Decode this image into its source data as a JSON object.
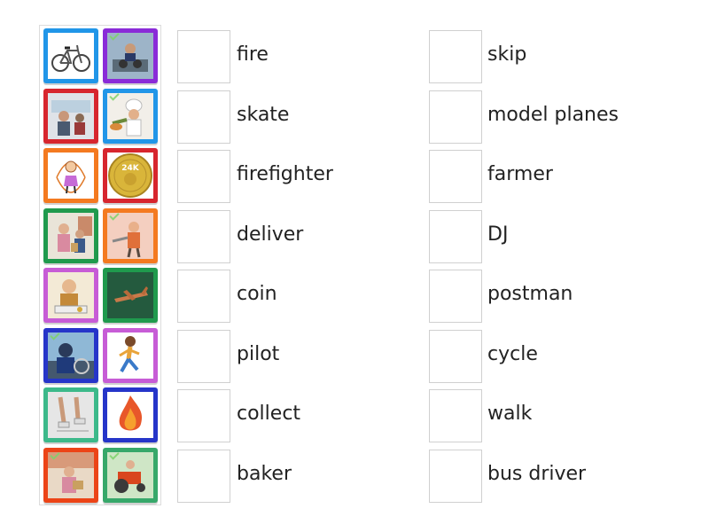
{
  "colors": {
    "red": "#d7262e",
    "purple": "#8a2bd8",
    "blue": "#2196e8",
    "orange": "#f47a20",
    "green": "#1f9a4d",
    "magenta": "#c75cd6",
    "navy": "#2635c9",
    "teal": "#3cb98a",
    "orangered": "#ec4417",
    "seagreen": "#37a86a"
  },
  "tiles": [
    {
      "icon": "bicycle-icon",
      "color": "#2196e8"
    },
    {
      "icon": "dj-icon",
      "color": "#8a2bd8"
    },
    {
      "icon": "bus-driver-icon",
      "color": "#d7262e"
    },
    {
      "icon": "baker-icon",
      "color": "#2196e8"
    },
    {
      "icon": "skipping-girl-icon",
      "color": "#f47a20"
    },
    {
      "icon": "gold-coin-icon",
      "color": "#d7262e"
    },
    {
      "icon": "postman-icon",
      "color": "#1f9a4d"
    },
    {
      "icon": "firefighter-icon",
      "color": "#f47a20"
    },
    {
      "icon": "collector-icon",
      "color": "#c75cd6"
    },
    {
      "icon": "model-plane-icon",
      "color": "#1f9a4d"
    },
    {
      "icon": "pilot-icon",
      "color": "#2635c9"
    },
    {
      "icon": "walking-boy-icon",
      "color": "#c75cd6"
    },
    {
      "icon": "skating-legs-icon",
      "color": "#3cb98a"
    },
    {
      "icon": "fire-icon",
      "color": "#2635c9"
    },
    {
      "icon": "delivery-icon",
      "color": "#ec4417"
    },
    {
      "icon": "farmer-tractor-icon",
      "color": "#37a86a"
    }
  ],
  "coin_label": "24K",
  "words_left": [
    "fire",
    "skate",
    "firefighter",
    "deliver",
    "coin",
    "pilot",
    "collect",
    "baker"
  ],
  "words_right": [
    "skip",
    "model planes",
    "farmer",
    "DJ",
    "postman",
    "cycle",
    "walk",
    "bus driver"
  ]
}
